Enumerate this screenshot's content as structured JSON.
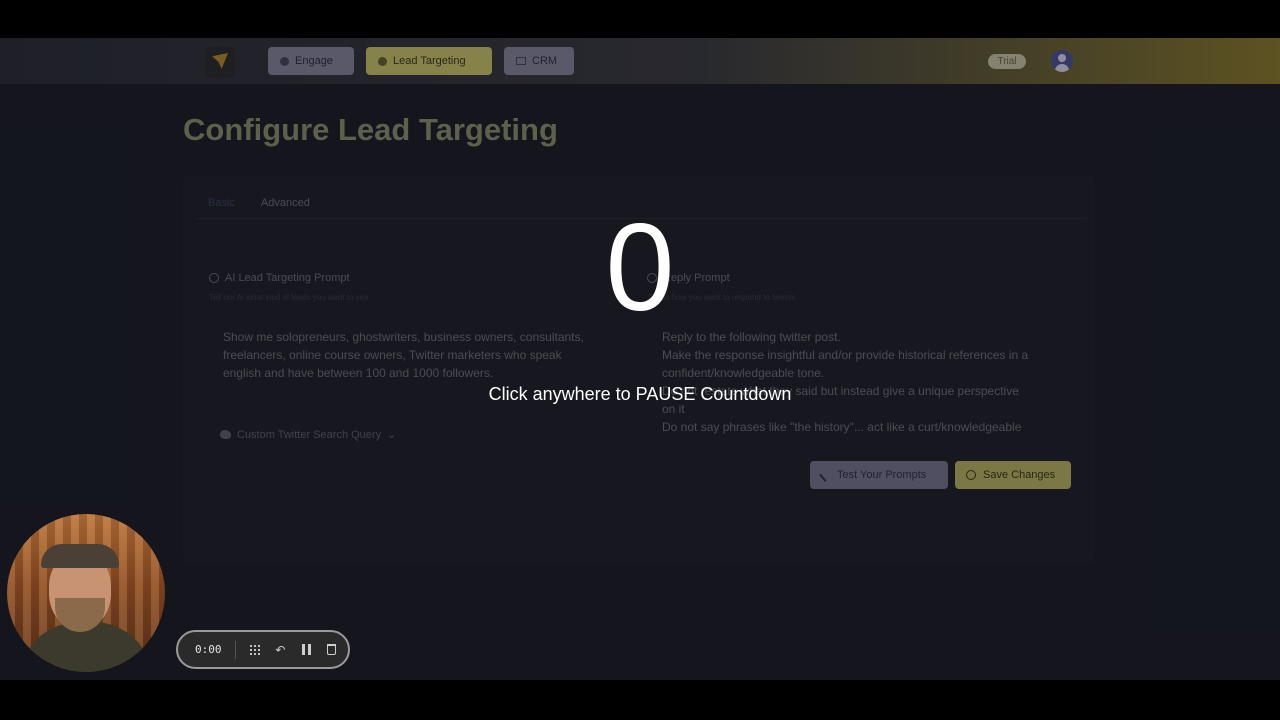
{
  "nav": {
    "engage": "Engage",
    "lead_targeting": "Lead Targeting",
    "crm": "CRM",
    "trial_badge": "Trial"
  },
  "page": {
    "title": "Configure Lead Targeting"
  },
  "tabs": {
    "basic": "Basic",
    "advanced": "Advanced"
  },
  "lead_prompt": {
    "title": "AI Lead Targeting Prompt",
    "subtitle": "Tell our AI what kind of leads you want to see",
    "lines": [
      "Show me solopreneurs, ghostwriters, business owners, consultants,",
      "freelancers, online course owners,  Twitter marketers who speak",
      "english and have between 100 and 1000 followers."
    ]
  },
  "reply_prompt": {
    "title": "Reply Prompt",
    "subtitle": "Tell us how you want to respond to tweets",
    "lines": [
      "Reply to the following twitter post.",
      "Make the response insightful and/or provide historical references in a",
      "confident/knowledgeable tone.",
      "Do not restate what they said but instead give a unique perspective",
      "on it",
      "Do not say phrases like \"the history\"... act like a curt/knowledgeable"
    ]
  },
  "search_query_label": "Custom Twitter Search Query",
  "actions": {
    "test": "Test Your Prompts",
    "save": "Save Changes"
  },
  "countdown": {
    "number": "0",
    "hint": "Click anywhere to PAUSE Countdown"
  },
  "recorder": {
    "time": "0:00"
  },
  "colors": {
    "accent_yellow": "#c9c36a",
    "nav_purple": "#85849b",
    "background": "#1b1d25"
  },
  "icons": [
    "engage-icon",
    "target-icon",
    "crm-icon",
    "user-avatar-icon",
    "twitter-icon",
    "wand-icon",
    "check-circle-icon",
    "grid-icon",
    "undo-icon",
    "pause-icon",
    "trash-icon"
  ]
}
